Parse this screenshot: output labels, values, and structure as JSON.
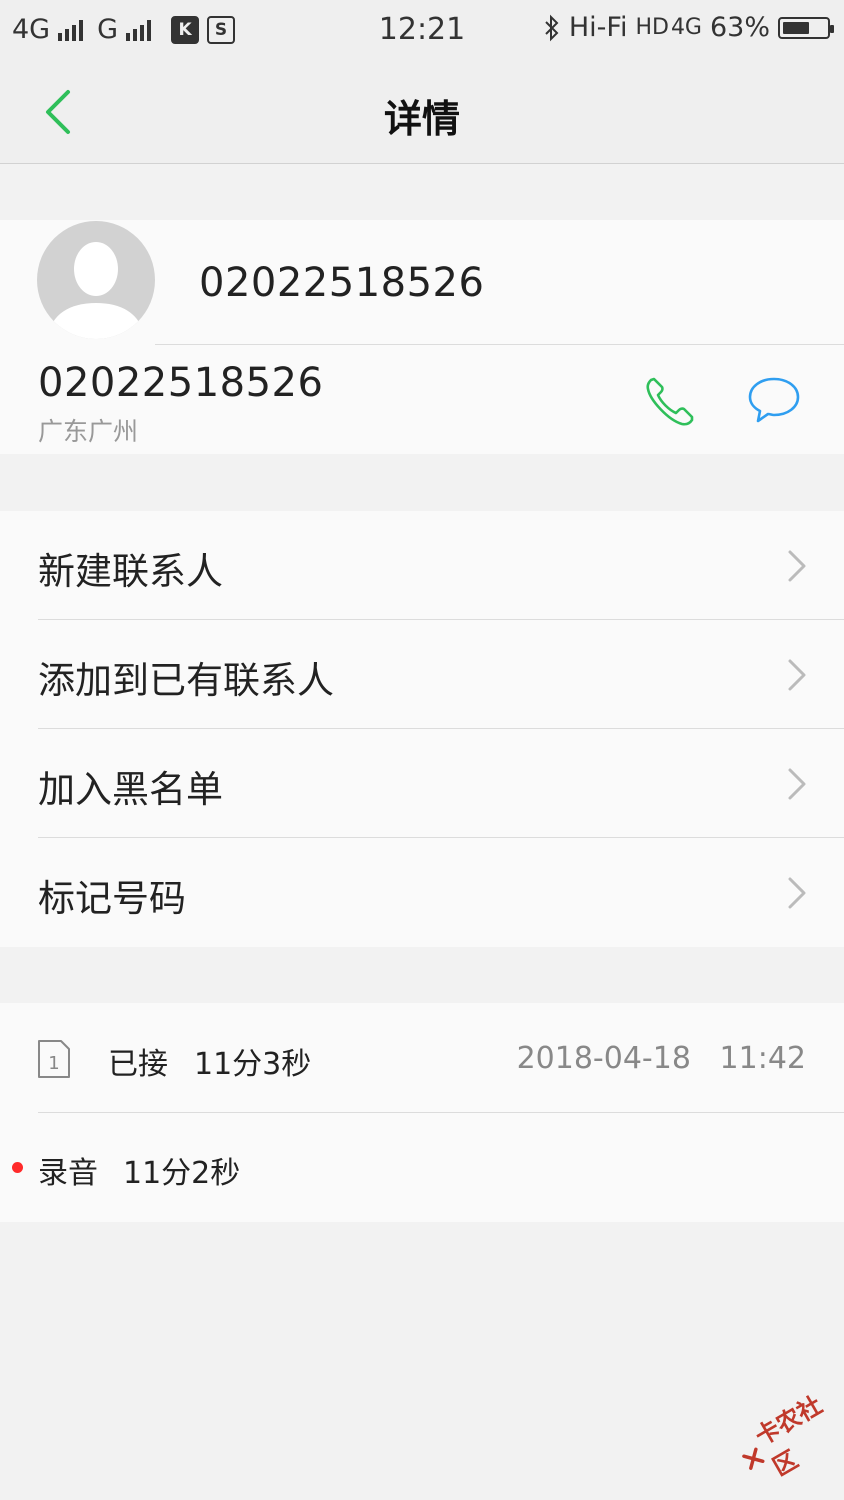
{
  "status_bar": {
    "network1": "4G",
    "network2": "G",
    "time": "12:21",
    "hifi": "Hi-Fi",
    "hd": "HD",
    "network3": "4G",
    "battery_percent_label": "63%",
    "battery_level": 0.63
  },
  "header": {
    "title": "详情"
  },
  "contact": {
    "header_number": "02022518526",
    "phone_number": "02022518526",
    "location": "广东广州"
  },
  "actions": [
    {
      "label": "新建联系人"
    },
    {
      "label": "添加到已有联系人"
    },
    {
      "label": "加入黑名单"
    },
    {
      "label": "标记号码"
    }
  ],
  "call_log": {
    "sim_slot": "1",
    "status": "已接",
    "duration": "11分3秒",
    "datetime": "2018-04-18   11:42",
    "recording_label": "录音",
    "recording_duration": "11分2秒"
  },
  "watermark": {
    "text": "卡农社区"
  },
  "colors": {
    "accent_green": "#2fbf5a",
    "message_blue": "#2f9ef0",
    "record_red": "#ff2a2a"
  }
}
